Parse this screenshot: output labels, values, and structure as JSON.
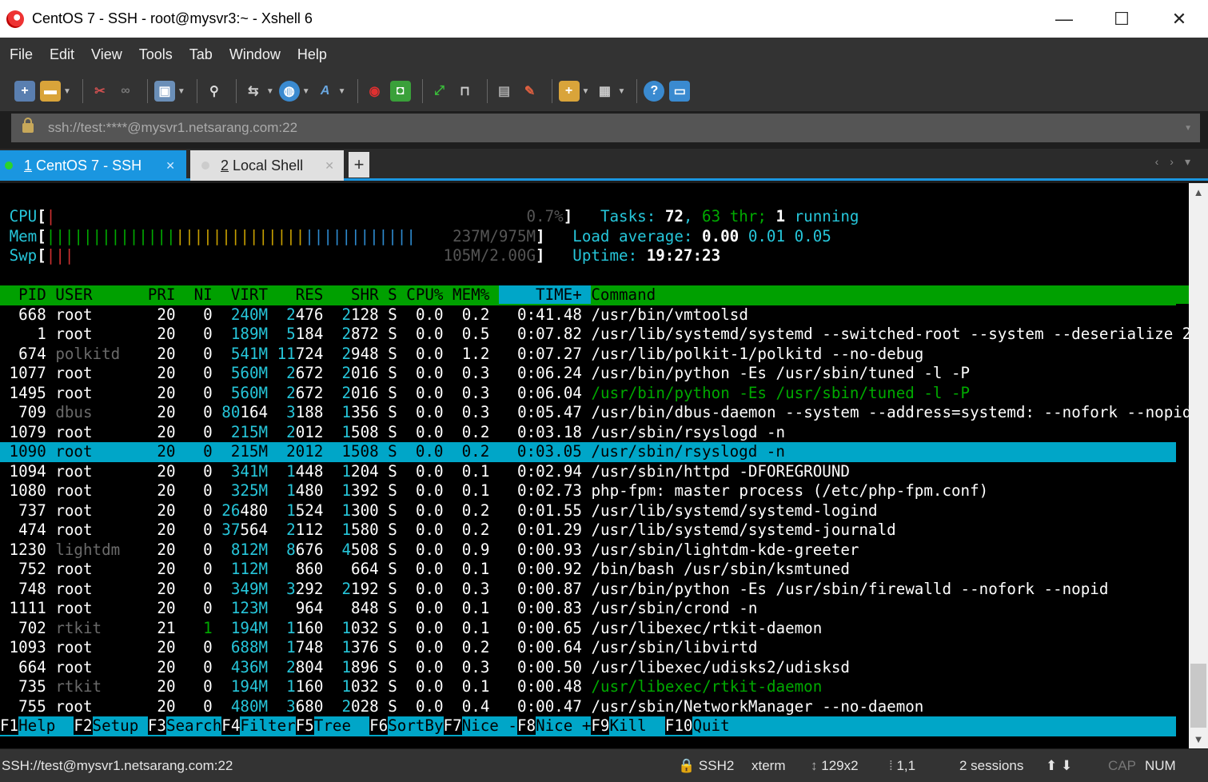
{
  "window": {
    "title": "CentOS 7 - SSH - root@mysvr3:~ - Xshell 6",
    "minimize": "—",
    "maximize": "☐",
    "close": "✕"
  },
  "menu": [
    "File",
    "Edit",
    "View",
    "Tools",
    "Tab",
    "Window",
    "Help"
  ],
  "address": {
    "url": "ssh://test:****@mysvr1.netsarang.com:22"
  },
  "tabs": [
    {
      "num": "1",
      "label": "CentOS 7 - SSH"
    },
    {
      "num": "2",
      "label": "Local Shell"
    }
  ],
  "htop": {
    "cpu_label": "CPU",
    "cpu_value": "0.7%",
    "mem_label": "Mem",
    "mem_value": "237M/975M",
    "swp_label": "Swp",
    "swp_value": "105M/2.00G",
    "tasks_label": "Tasks:",
    "tasks": "72",
    "thr": "63",
    "thr_label": "thr;",
    "running": "1",
    "running_label": "running",
    "load_label": "Load average:",
    "load1": "0.00",
    "load5": "0.01",
    "load15": "0.05",
    "uptime_label": "Uptime:",
    "uptime": "19:27:23",
    "header": {
      "pid": "PID",
      "user": "USER",
      "pri": "PRI",
      "ni": "NI",
      "virt": "VIRT",
      "res": "RES",
      "shr": "SHR",
      "s": "S",
      "cpu": "CPU%",
      "mem": "MEM%",
      "time": "TIME+",
      "cmd": "Command"
    },
    "processes": [
      {
        "pid": "668",
        "user": "root",
        "pri": "20",
        "ni": "0",
        "virt": "240M",
        "res": "2476",
        "shr": "2128",
        "s": "S",
        "cpu": "0.0",
        "mem": "0.2",
        "time": "0:41.48",
        "cmd": "/usr/bin/vmtoolsd"
      },
      {
        "pid": "1",
        "user": "root",
        "pri": "20",
        "ni": "0",
        "virt": "189M",
        "res": "5184",
        "shr": "2872",
        "s": "S",
        "cpu": "0.0",
        "mem": "0.5",
        "time": "0:07.82",
        "cmd": "/usr/lib/systemd/systemd --switched-root --system --deserialize 2"
      },
      {
        "pid": "674",
        "user": "polkitd",
        "pri": "20",
        "ni": "0",
        "virt": "541M",
        "res": "11724",
        "shr": "2948",
        "s": "S",
        "cpu": "0.0",
        "mem": "1.2",
        "time": "0:07.27",
        "cmd": "/usr/lib/polkit-1/polkitd --no-debug"
      },
      {
        "pid": "1077",
        "user": "root",
        "pri": "20",
        "ni": "0",
        "virt": "560M",
        "res": "2672",
        "shr": "2016",
        "s": "S",
        "cpu": "0.0",
        "mem": "0.3",
        "time": "0:06.24",
        "cmd": "/usr/bin/python -Es /usr/sbin/tuned -l -P"
      },
      {
        "pid": "1495",
        "user": "root",
        "pri": "20",
        "ni": "0",
        "virt": "560M",
        "res": "2672",
        "shr": "2016",
        "s": "S",
        "cpu": "0.0",
        "mem": "0.3",
        "time": "0:06.04",
        "cmd": "/usr/bin/python -Es /usr/sbin/tuned -l -P"
      },
      {
        "pid": "709",
        "user": "dbus",
        "pri": "20",
        "ni": "0",
        "virt": "80164",
        "res": "3188",
        "shr": "1356",
        "s": "S",
        "cpu": "0.0",
        "mem": "0.3",
        "time": "0:05.47",
        "cmd": "/usr/bin/dbus-daemon --system --address=systemd: --nofork --nopid"
      },
      {
        "pid": "1079",
        "user": "root",
        "pri": "20",
        "ni": "0",
        "virt": "215M",
        "res": "2012",
        "shr": "1508",
        "s": "S",
        "cpu": "0.0",
        "mem": "0.2",
        "time": "0:03.18",
        "cmd": "/usr/sbin/rsyslogd -n"
      },
      {
        "pid": "1090",
        "user": "root",
        "pri": "20",
        "ni": "0",
        "virt": "215M",
        "res": "2012",
        "shr": "1508",
        "s": "S",
        "cpu": "0.0",
        "mem": "0.2",
        "time": "0:03.05",
        "cmd": "/usr/sbin/rsyslogd -n"
      },
      {
        "pid": "1094",
        "user": "root",
        "pri": "20",
        "ni": "0",
        "virt": "341M",
        "res": "1448",
        "shr": "1204",
        "s": "S",
        "cpu": "0.0",
        "mem": "0.1",
        "time": "0:02.94",
        "cmd": "/usr/sbin/httpd -DFOREGROUND"
      },
      {
        "pid": "1080",
        "user": "root",
        "pri": "20",
        "ni": "0",
        "virt": "325M",
        "res": "1480",
        "shr": "1392",
        "s": "S",
        "cpu": "0.0",
        "mem": "0.1",
        "time": "0:02.73",
        "cmd": "php-fpm: master process (/etc/php-fpm.conf)"
      },
      {
        "pid": "737",
        "user": "root",
        "pri": "20",
        "ni": "0",
        "virt": "26480",
        "res": "1524",
        "shr": "1300",
        "s": "S",
        "cpu": "0.0",
        "mem": "0.2",
        "time": "0:01.55",
        "cmd": "/usr/lib/systemd/systemd-logind"
      },
      {
        "pid": "474",
        "user": "root",
        "pri": "20",
        "ni": "0",
        "virt": "37564",
        "res": "2112",
        "shr": "1580",
        "s": "S",
        "cpu": "0.0",
        "mem": "0.2",
        "time": "0:01.29",
        "cmd": "/usr/lib/systemd/systemd-journald"
      },
      {
        "pid": "1230",
        "user": "lightdm",
        "pri": "20",
        "ni": "0",
        "virt": "812M",
        "res": "8676",
        "shr": "4508",
        "s": "S",
        "cpu": "0.0",
        "mem": "0.9",
        "time": "0:00.93",
        "cmd": "/usr/sbin/lightdm-kde-greeter"
      },
      {
        "pid": "752",
        "user": "root",
        "pri": "20",
        "ni": "0",
        "virt": "112M",
        "res": "860",
        "shr": "664",
        "s": "S",
        "cpu": "0.0",
        "mem": "0.1",
        "time": "0:00.92",
        "cmd": "/bin/bash /usr/sbin/ksmtuned"
      },
      {
        "pid": "748",
        "user": "root",
        "pri": "20",
        "ni": "0",
        "virt": "349M",
        "res": "3292",
        "shr": "2192",
        "s": "S",
        "cpu": "0.0",
        "mem": "0.3",
        "time": "0:00.87",
        "cmd": "/usr/bin/python -Es /usr/sbin/firewalld --nofork --nopid"
      },
      {
        "pid": "1111",
        "user": "root",
        "pri": "20",
        "ni": "0",
        "virt": "123M",
        "res": "964",
        "shr": "848",
        "s": "S",
        "cpu": "0.0",
        "mem": "0.1",
        "time": "0:00.83",
        "cmd": "/usr/sbin/crond -n"
      },
      {
        "pid": "702",
        "user": "rtkit",
        "pri": "21",
        "ni": "1",
        "virt": "194M",
        "res": "1160",
        "shr": "1032",
        "s": "S",
        "cpu": "0.0",
        "mem": "0.1",
        "time": "0:00.65",
        "cmd": "/usr/libexec/rtkit-daemon"
      },
      {
        "pid": "1093",
        "user": "root",
        "pri": "20",
        "ni": "0",
        "virt": "688M",
        "res": "1748",
        "shr": "1376",
        "s": "S",
        "cpu": "0.0",
        "mem": "0.2",
        "time": "0:00.64",
        "cmd": "/usr/sbin/libvirtd"
      },
      {
        "pid": "664",
        "user": "root",
        "pri": "20",
        "ni": "0",
        "virt": "436M",
        "res": "2804",
        "shr": "1896",
        "s": "S",
        "cpu": "0.0",
        "mem": "0.3",
        "time": "0:00.50",
        "cmd": "/usr/libexec/udisks2/udisksd"
      },
      {
        "pid": "735",
        "user": "rtkit",
        "pri": "20",
        "ni": "0",
        "virt": "194M",
        "res": "1160",
        "shr": "1032",
        "s": "S",
        "cpu": "0.0",
        "mem": "0.1",
        "time": "0:00.48",
        "cmd": "/usr/libexec/rtkit-daemon"
      },
      {
        "pid": "755",
        "user": "root",
        "pri": "20",
        "ni": "0",
        "virt": "480M",
        "res": "3680",
        "shr": "2028",
        "s": "S",
        "cpu": "0.0",
        "mem": "0.4",
        "time": "0:00.47",
        "cmd": "/usr/sbin/NetworkManager --no-daemon"
      }
    ],
    "fkeys": [
      {
        "key": "F1",
        "label": "Help  "
      },
      {
        "key": "F2",
        "label": "Setup "
      },
      {
        "key": "F3",
        "label": "Search"
      },
      {
        "key": "F4",
        "label": "Filter"
      },
      {
        "key": "F5",
        "label": "Tree  "
      },
      {
        "key": "F6",
        "label": "SortBy"
      },
      {
        "key": "F7",
        "label": "Nice -"
      },
      {
        "key": "F8",
        "label": "Nice +"
      },
      {
        "key": "F9",
        "label": "Kill  "
      },
      {
        "key": "F10",
        "label": "Quit"
      }
    ]
  },
  "status": {
    "connection": "SSH://test@mysvr1.netsarang.com:22",
    "protocol": "SSH2",
    "term": "xterm",
    "size": "129x2",
    "pos": "1,1",
    "sessions": "2 sessions",
    "cap": "CAP",
    "num": "NUM"
  },
  "colors": {
    "accent": "#1a96e0",
    "header_green": "#00a000",
    "highlight": "#00a6c8"
  }
}
